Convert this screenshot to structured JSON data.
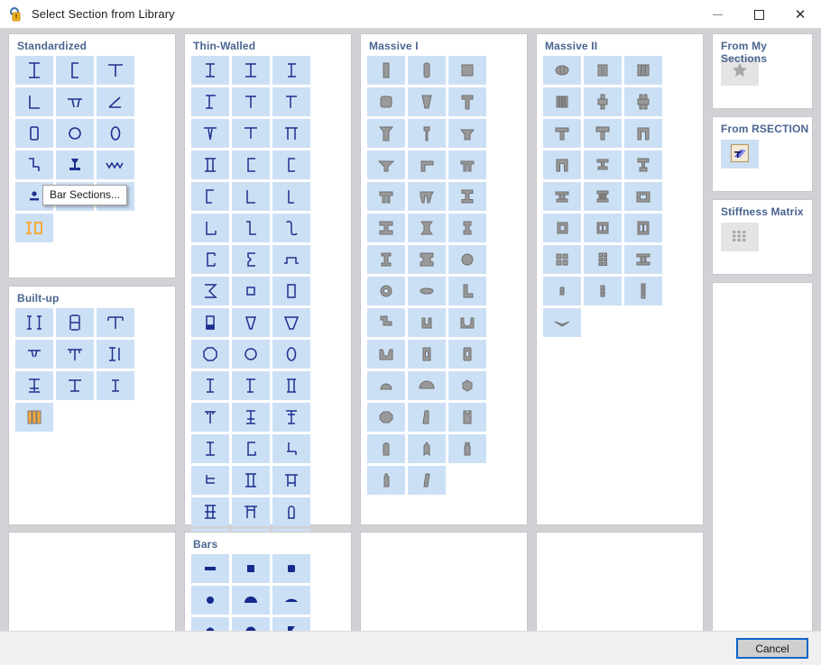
{
  "window": {
    "title": "Select Section from Library",
    "icon": "library-lock-icon",
    "controls": {
      "minimize": "minimize-icon",
      "maximize": "maximize-icon",
      "close": "close-icon"
    }
  },
  "colors": {
    "tile_bg": "#cce0f5",
    "tile_bg_disabled": "#e4e4e4",
    "glyph_navy": "#1f2f8f",
    "glyph_gray": "#9a9a9a",
    "glyph_gray_stroke": "#6e6e6e",
    "glyph_orange": "#f7a83c",
    "glyph_orange_stroke": "#7a7a7a",
    "panel_header": "#4a6591",
    "workspace_bg": "#d2d2d6",
    "accent_focus": "#0a64c8"
  },
  "panels": {
    "standardized": {
      "title": "Standardized",
      "tile_count": 16
    },
    "built_up": {
      "title": "Built-up",
      "tile_count": 10
    },
    "thin_walled": {
      "title": "Thin-Walled",
      "tile_count": 53
    },
    "massive_i": {
      "title": "Massive I",
      "tile_count": 37
    },
    "massive_ii": {
      "title": "Massive II",
      "tile_count": 25
    },
    "bars": {
      "title": "Bars",
      "tile_count": 9
    },
    "empty_left": {
      "title": ""
    },
    "empty_massive_i": {
      "title": ""
    },
    "empty_massive_ii": {
      "title": ""
    }
  },
  "sidebar": {
    "from_my_sections": {
      "title": "From My Sections",
      "icon": "star-icon",
      "enabled": false
    },
    "from_rsection": {
      "title": "From RSECTION",
      "icon": "rsection-icon",
      "enabled": true
    },
    "stiffness_matrix": {
      "title": "Stiffness Matrix",
      "icon": "matrix-grid-icon",
      "enabled": false
    },
    "empty_panel": {
      "title": ""
    }
  },
  "tooltip": {
    "text": "Bar Sections..."
  },
  "footer": {
    "cancel_label": "Cancel"
  }
}
